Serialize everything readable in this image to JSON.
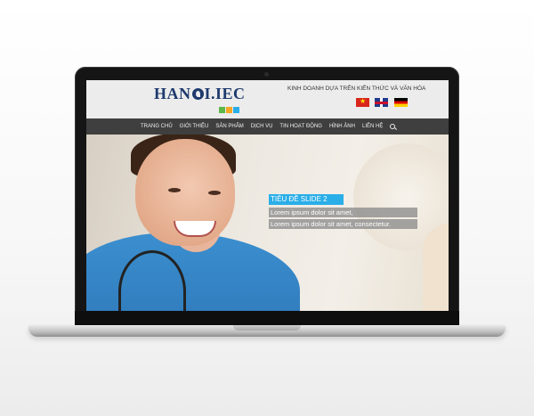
{
  "site": {
    "logo_text": "HAN",
    "logo_text_end": "I.IEC",
    "logo_subtitle": "",
    "tagline": "KINH DOANH DỰA TRÊN KIẾN THỨC VÀ VĂN HÓA",
    "languages": [
      "Vietnamese",
      "English",
      "German"
    ]
  },
  "nav": {
    "items": [
      "TRANG CHỦ",
      "GIỚI THIỆU",
      "SẢN PHẨM",
      "DỊCH VỤ",
      "TIN HOẠT ĐỘNG",
      "HÌNH ẢNH",
      "LIÊN HỆ"
    ]
  },
  "hero": {
    "slide_title": "TIÊU ĐỀ SLIDE 2",
    "line1": "Lorem ipsum dolor sit amet,",
    "line2": "Lorem ipsum dolor sit amet, consectetur."
  },
  "colors": {
    "accent": "#2aaee8",
    "nav_bg": "#3f3f3f",
    "logo_blue": "#1e3a6d"
  }
}
